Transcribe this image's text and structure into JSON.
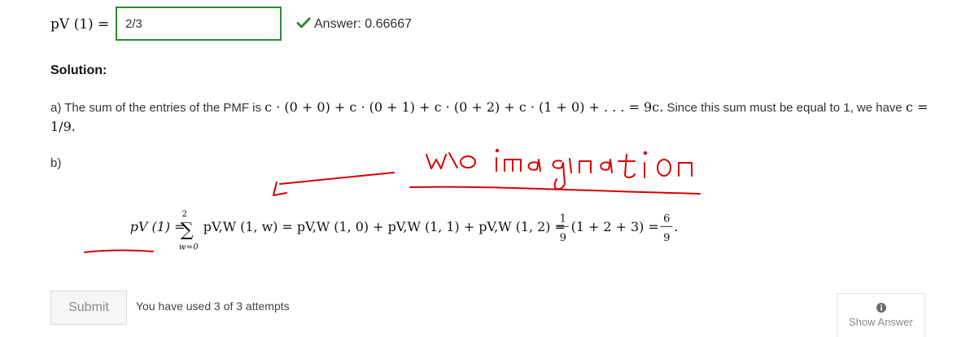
{
  "question": {
    "lhs": "pV (1) =",
    "input_value": "2/3",
    "answer_label": "Answer: 0.66667"
  },
  "solution": {
    "heading": "Solution:",
    "part_a_prefix": "a) The sum of the entries of the PMF is",
    "part_a_math": "c · (0 + 0) + c · (0 + 1) + c · (0 + 2) + c · (1 + 0) + . . . = 9c.",
    "part_a_middle": "Since this sum must be equal to 1, we have",
    "part_a_result": "c = 1/9.",
    "part_b_label": "b)",
    "equation": {
      "lhs": "pV (1) =",
      "sum_upper": "2",
      "sum_lower": "w=0",
      "body": "pV,W (1, w) = pV,W (1, 0) + pV,W (1, 1) + pV,W (1, 2) =",
      "frac1_num": "1",
      "frac1_den": "9",
      "paren": "(1 + 2 + 3) =",
      "frac2_num": "6",
      "frac2_den": "9",
      "end": "."
    }
  },
  "annotation": {
    "handwritten": "w\\o imagination",
    "color": "#d80000"
  },
  "footer": {
    "submit_label": "Submit",
    "attempts_text": "You have used 3 of 3 attempts",
    "show_answer_label": "Show Answer"
  },
  "colors": {
    "correct_green": "#2e8b32",
    "annotation_red": "#d80000"
  }
}
